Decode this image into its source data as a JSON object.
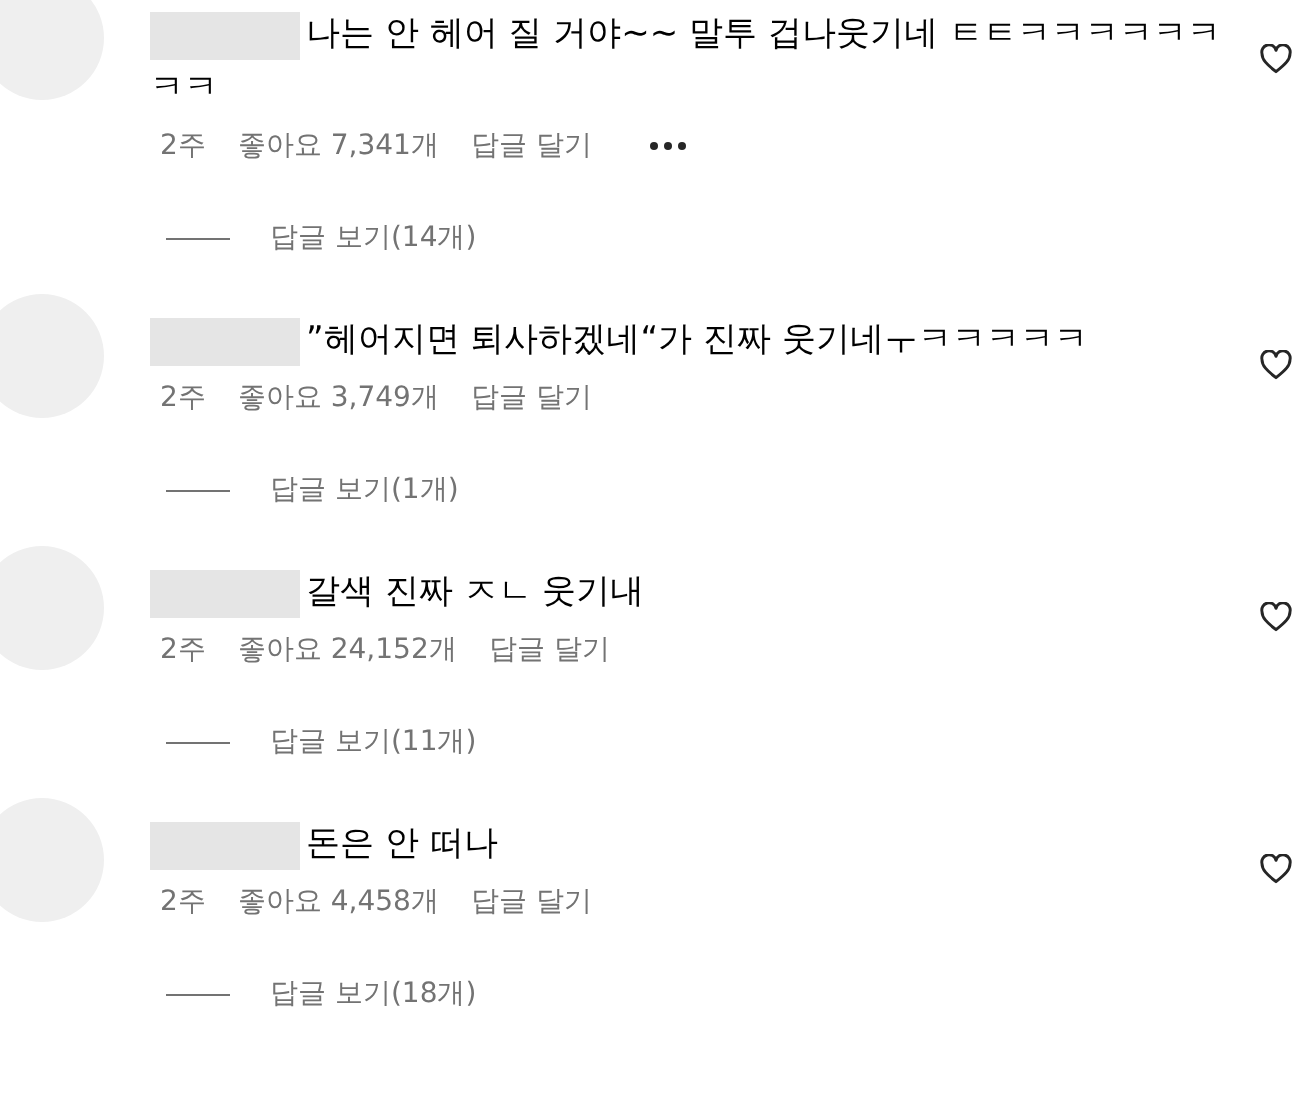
{
  "comments": [
    {
      "text": "나는 안 헤어 질 거야~~ 말투 겁나웃기네 ㅌㅌㅋㅋㅋㅋㅋㅋㅋㅋ",
      "time": "2주",
      "likes": "좋아요 7,341개",
      "reply": "답글 달기",
      "show_more": true,
      "view_replies": "답글 보기(14개)"
    },
    {
      "text": "”헤어지면 퇴사하겠네“가 진짜 웃기네ㅜㅋㅋㅋㅋㅋ",
      "time": "2주",
      "likes": "좋아요 3,749개",
      "reply": "답글 달기",
      "show_more": false,
      "view_replies": "답글 보기(1개)"
    },
    {
      "text": "갈색 진짜 ㅈㄴ 웃기내",
      "time": "2주",
      "likes": "좋아요 24,152개",
      "reply": "답글 달기",
      "show_more": false,
      "view_replies": "답글 보기(11개)"
    },
    {
      "text": "돈은 안 떠나",
      "time": "2주",
      "likes": "좋아요 4,458개",
      "reply": "답글 달기",
      "show_more": false,
      "view_replies": "답글 보기(18개)"
    }
  ]
}
